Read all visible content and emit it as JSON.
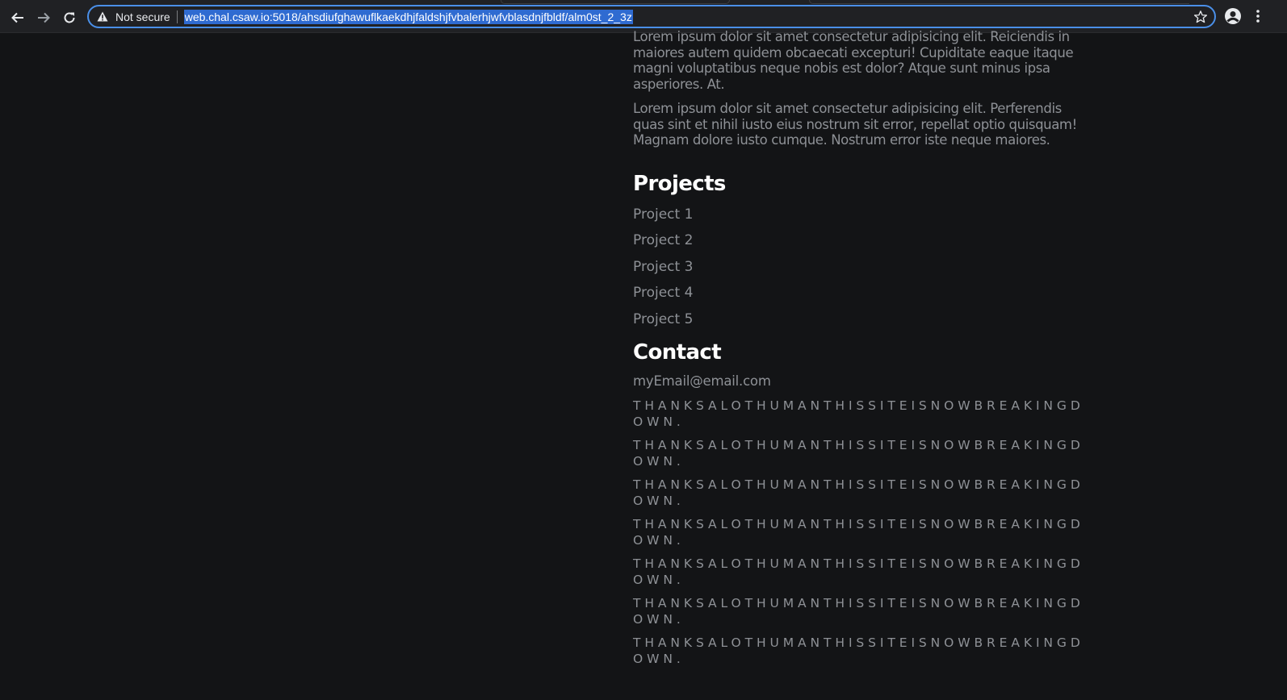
{
  "browser": {
    "security_label": "Not secure",
    "url": "web.chal.csaw.io:5018/ahsdiufghawuflkaekdhjfaldshjfvbalerhjwfvblasdnjfbldf/alm0st_2_3z",
    "icons": [
      "back-arrow-icon",
      "forward-arrow-icon",
      "reload-icon",
      "warning-icon",
      "star-icon",
      "profile-icon",
      "more-menu-icon"
    ],
    "accent_color": "#4a8fe8"
  },
  "about": {
    "paragraphs": [
      "Lorem ipsum dolor sit amet consectetur adipisicing elit. Reiciendis in maiores autem quidem obcaecati excepturi! Cupiditate eaque itaque magni voluptatibus neque nobis est dolor? Atque sunt minus ipsa asperiores. At.",
      "Lorem ipsum dolor sit amet consectetur adipisicing elit. Perferendis quas sint et nihil iusto eius nostrum sit error, repellat optio quisquam! Magnam dolore iusto cumque. Nostrum error iste neque maiores."
    ]
  },
  "projects": {
    "heading": "Projects",
    "items": [
      "Project 1",
      "Project 2",
      "Project 3",
      "Project 4",
      "Project 5"
    ]
  },
  "contact": {
    "heading": "Contact",
    "email": "myEmail@email.com",
    "messages": [
      "THANKSALOTHUMANTHISSITEISNOWBREAKINGDOWN.",
      "THANKSALOTHUMANTHISSITEISNOWBREAKINGDOWN.",
      "THANKSALOTHUMANTHISSITEISNOWBREAKINGDOWN.",
      "THANKSALOTHUMANTHISSITEISNOWBREAKINGDOWN.",
      "THANKSALOTHUMANTHISSITEISNOWBREAKINGDOWN.",
      "THANKSALOTHUMANTHISSITEISNOWBREAKINGDOWN.",
      "THANKSALOTHUMANTHISSITEISNOWBREAKINGDOWN."
    ]
  },
  "colors": {
    "page_background": "#131416",
    "body_text": "#8e9196",
    "heading_text": "#ffffff",
    "url_highlight": "#2f6bd1"
  }
}
